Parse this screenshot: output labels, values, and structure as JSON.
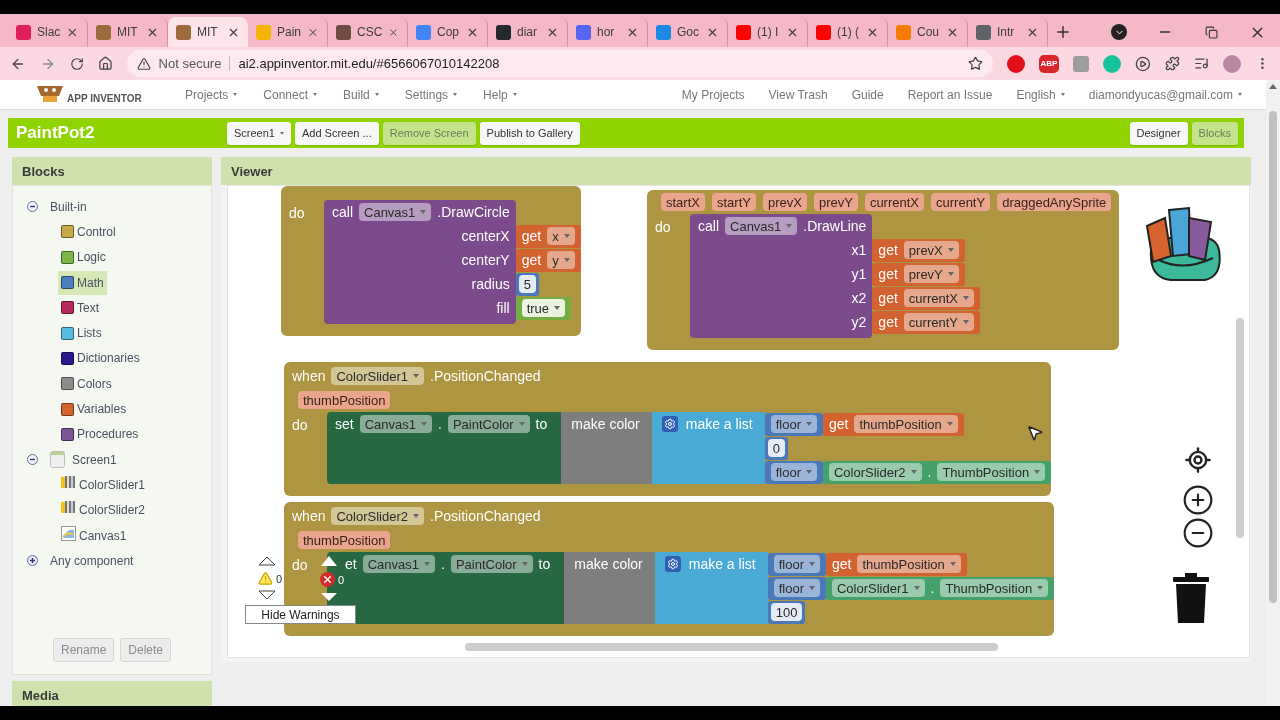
{
  "browser": {
    "tabs": [
      {
        "label": "Slac",
        "color": "#e01e5a",
        "selected": false
      },
      {
        "label": "MIT",
        "color": "#9c6b3c",
        "selected": false
      },
      {
        "label": "MIT",
        "color": "#9c6b3c",
        "selected": true
      },
      {
        "label": "Pain",
        "color": "#f4b400",
        "selected": false
      },
      {
        "label": "CSC",
        "color": "#6d4c41",
        "selected": false
      },
      {
        "label": "Cop",
        "color": "#4285f4",
        "selected": false
      },
      {
        "label": "diar",
        "color": "#24292e",
        "selected": false
      },
      {
        "label": "hor",
        "color": "#5865f2",
        "selected": false
      },
      {
        "label": "Goc",
        "color": "#1e88e5",
        "selected": false
      },
      {
        "label": "(1) I",
        "color": "#ff0000",
        "selected": false
      },
      {
        "label": "(1) (",
        "color": "#ff0000",
        "selected": false
      },
      {
        "label": "Cou",
        "color": "#f57c00",
        "selected": false
      },
      {
        "label": "Intr",
        "color": "#5f6368",
        "selected": false
      }
    ],
    "address": {
      "security": "Not secure",
      "url": "ai2.appinventor.mit.edu/#6566067010142208"
    },
    "adblock": "ABP"
  },
  "app": {
    "logo": "APP INVENTOR",
    "menu": [
      {
        "label": "Projects",
        "dropdown": true
      },
      {
        "label": "Connect",
        "dropdown": true
      },
      {
        "label": "Build",
        "dropdown": true
      },
      {
        "label": "Settings",
        "dropdown": true
      },
      {
        "label": "Help",
        "dropdown": true
      }
    ],
    "right_menu": [
      {
        "label": "My Projects",
        "dropdown": false
      },
      {
        "label": "View Trash",
        "dropdown": false
      },
      {
        "label": "Guide",
        "dropdown": false
      },
      {
        "label": "Report an Issue",
        "dropdown": false
      },
      {
        "label": "English",
        "dropdown": true
      },
      {
        "label": "diamondyucas@gmail.com",
        "dropdown": true
      }
    ]
  },
  "project": {
    "name": "PaintPot2",
    "buttons": [
      {
        "label": "Screen1",
        "dropdown": true,
        "disabled": false
      },
      {
        "label": "Add Screen ...",
        "dropdown": false,
        "disabled": false
      },
      {
        "label": "Remove Screen",
        "dropdown": false,
        "disabled": true
      },
      {
        "label": "Publish to Gallery",
        "dropdown": false,
        "disabled": false
      }
    ],
    "views": [
      {
        "label": "Designer",
        "selected": false
      },
      {
        "label": "Blocks",
        "selected": true
      }
    ]
  },
  "blocks_panel": {
    "title": "Blocks",
    "tree": [
      {
        "label": "Built-in",
        "kind": "group",
        "expanded": true,
        "selected": false,
        "children": [
          {
            "label": "Control",
            "kind": "category",
            "color": "#c9a948",
            "selected": false
          },
          {
            "label": "Logic",
            "kind": "category",
            "color": "#7ab648",
            "selected": false
          },
          {
            "label": "Math",
            "kind": "category",
            "color": "#4f7ec0",
            "selected": true
          },
          {
            "label": "Text",
            "kind": "category",
            "color": "#b5295f",
            "selected": false
          },
          {
            "label": "Lists",
            "kind": "category",
            "color": "#56bde0",
            "selected": false
          },
          {
            "label": "Dictionaries",
            "kind": "category",
            "color": "#2a1690",
            "selected": false
          },
          {
            "label": "Colors",
            "kind": "category",
            "color": "#8c8c8c",
            "selected": false
          },
          {
            "label": "Variables",
            "kind": "category",
            "color": "#d4642e",
            "selected": false
          },
          {
            "label": "Procedures",
            "kind": "category",
            "color": "#7d5597",
            "selected": false
          }
        ]
      },
      {
        "label": "Screen1",
        "kind": "screen",
        "expanded": true,
        "selected": false,
        "children": [
          {
            "label": "ColorSlider1",
            "kind": "slider",
            "selected": false
          },
          {
            "label": "ColorSlider2",
            "kind": "slider",
            "selected": false
          },
          {
            "label": "Canvas1",
            "kind": "canvas",
            "selected": false
          }
        ]
      },
      {
        "label": "Any component",
        "kind": "group",
        "expanded": false,
        "selected": false
      }
    ],
    "buttons": [
      {
        "label": "Rename",
        "disabled": true
      },
      {
        "label": "Delete",
        "disabled": true
      }
    ]
  },
  "media_panel": {
    "title": "Media"
  },
  "viewer": {
    "title": "Viewer",
    "blocks": [
      {
        "do": "do",
        "body": {
          "kind": "call",
          "call": "call",
          "component": "Canvas1",
          "method": ".DrawCircle",
          "args": [
            {
              "name": "centerX",
              "value": {
                "kind": "get",
                "get": "get",
                "var": "x"
              }
            },
            {
              "name": "centerY",
              "value": {
                "kind": "get",
                "get": "get",
                "var": "y"
              }
            },
            {
              "name": "radius",
              "value": {
                "kind": "number",
                "text": "5"
              }
            },
            {
              "name": "fill",
              "value": {
                "kind": "logic",
                "text": "true"
              }
            }
          ]
        }
      },
      {
        "params": [
          "startX",
          "startY",
          "prevX",
          "prevY",
          "currentX",
          "currentY",
          "draggedAnySprite"
        ],
        "do": "do",
        "body": {
          "kind": "call",
          "call": "call",
          "component": "Canvas1",
          "method": ".DrawLine",
          "args": [
            {
              "name": "x1",
              "value": {
                "kind": "get",
                "get": "get",
                "var": "prevX"
              }
            },
            {
              "name": "y1",
              "value": {
                "kind": "get",
                "get": "get",
                "var": "prevY"
              }
            },
            {
              "name": "x2",
              "value": {
                "kind": "get",
                "get": "get",
                "var": "currentX"
              }
            },
            {
              "name": "y2",
              "value": {
                "kind": "get",
                "get": "get",
                "var": "currentY"
              }
            }
          ]
        }
      },
      {
        "when": "when",
        "component": "ColorSlider1",
        "event": ".PositionChanged",
        "params": [
          "thumbPosition"
        ],
        "do": "do",
        "body": {
          "kind": "set",
          "set": "set",
          "component": "Canvas1",
          "dot": ".",
          "property": "PaintColor",
          "to": "to",
          "color_block": "make color",
          "list": "make a list",
          "items": [
            {
              "kind": "floor_get",
              "fn": "floor",
              "get": "get",
              "var": "thumbPosition"
            },
            {
              "kind": "number",
              "text": "0"
            },
            {
              "kind": "floor_prop",
              "fn": "floor",
              "component": "ColorSlider2",
              "dot": ".",
              "property": "ThumbPosition"
            }
          ]
        }
      },
      {
        "when": "when",
        "component": "ColorSlider2",
        "event": ".PositionChanged",
        "params": [
          "thumbPosition"
        ],
        "do": "do",
        "body": {
          "kind": "set",
          "set": "et",
          "component": "Canvas1",
          "dot": ".",
          "property": "PaintColor",
          "to": "to",
          "color_block": "make color",
          "list": "make a list",
          "items": [
            {
              "kind": "floor_get",
              "fn": "floor",
              "get": "get",
              "var": "thumbPosition"
            },
            {
              "kind": "floor_prop",
              "fn": "floor",
              "component": "ColorSlider1",
              "dot": ".",
              "property": "ThumbPosition"
            },
            {
              "kind": "number",
              "text": "100"
            }
          ]
        }
      }
    ],
    "warnings": {
      "warning_count": "0",
      "error_count": "0",
      "toggle": "Hide Warnings"
    }
  }
}
